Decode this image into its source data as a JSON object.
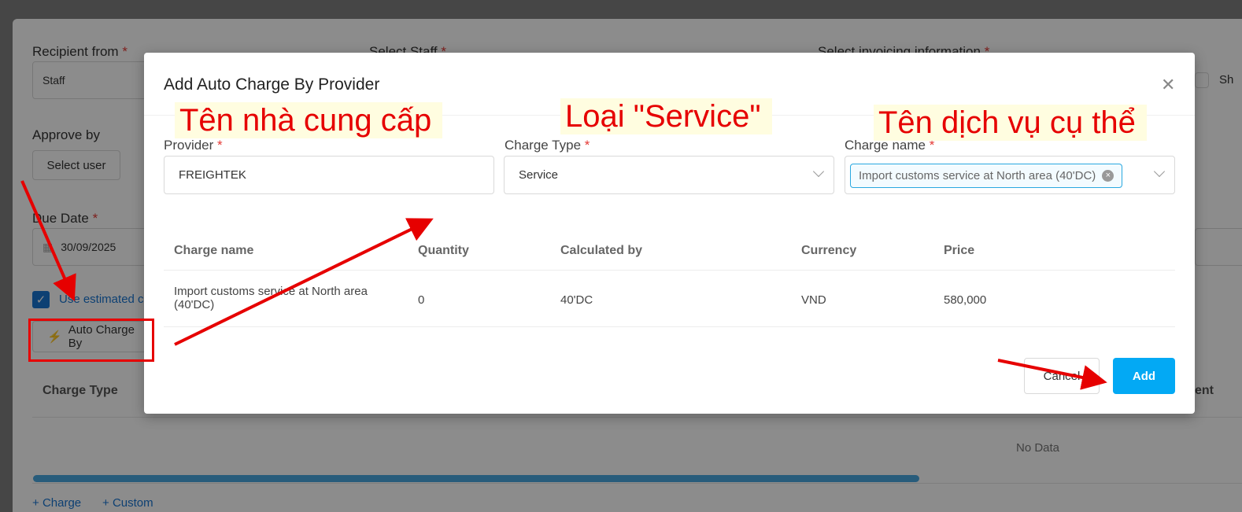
{
  "background": {
    "recipient_label": "Recipient from",
    "recipient_value": "Staff",
    "staff_label": "Select Staff",
    "invoice_label": "Select invoicing information",
    "show_label": "Sh",
    "approve_label": "Approve by",
    "select_user": "Select user",
    "due_label": "Due Date",
    "due_value": "30/09/2025",
    "estimated_label": "Use estimated c",
    "auto_charge_btn": "Auto Charge By",
    "charge_type_col": "Charge Type",
    "right_col": "ent",
    "no_data": "No Data",
    "add_charge": "Charge",
    "add_custom": "Custom",
    "required_mark": "*"
  },
  "modal": {
    "title": "Add Auto Charge By Provider",
    "provider_label": "Provider",
    "provider_value": "FREIGHTEK",
    "charge_type_label": "Charge Type",
    "charge_type_value": "Service",
    "charge_name_label": "Charge name",
    "charge_name_tag": "Import customs service at North area (40'DC)",
    "table": {
      "columns": [
        "Charge name",
        "Quantity",
        "Calculated by",
        "Currency",
        "Price"
      ],
      "rows": [
        {
          "name_line1": "Import customs service at North area",
          "name_line2": "(40'DC)",
          "quantity": "0",
          "calculated_by": "40'DC",
          "currency": "VND",
          "price": "580,000"
        }
      ]
    },
    "cancel_label": "Cancel",
    "add_label": "Add"
  },
  "annotations": {
    "provider_note": "Tên nhà cung cấp",
    "type_note": "Loại \"Service\"",
    "name_note": "Tên dịch vụ cụ thể"
  }
}
